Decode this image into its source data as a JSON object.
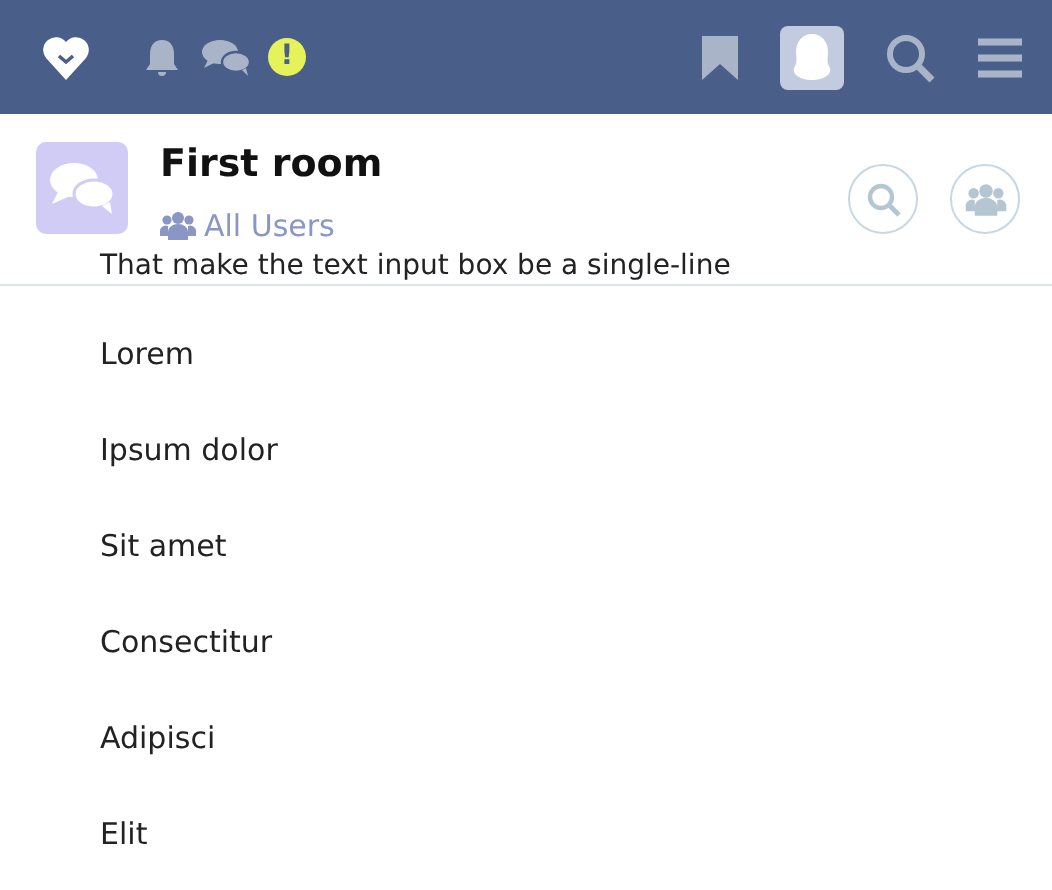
{
  "topbar": {
    "alert_badge": "!"
  },
  "room": {
    "title": "First room",
    "audience": "All Users"
  },
  "partial_message": "That make the text input box be a single-line",
  "menu_items": [
    {
      "label": "Lorem"
    },
    {
      "label": "Ipsum dolor"
    },
    {
      "label": "Sit amet"
    },
    {
      "label": "Consectitur"
    },
    {
      "label": "Adipisci"
    },
    {
      "label": "Elit"
    }
  ]
}
